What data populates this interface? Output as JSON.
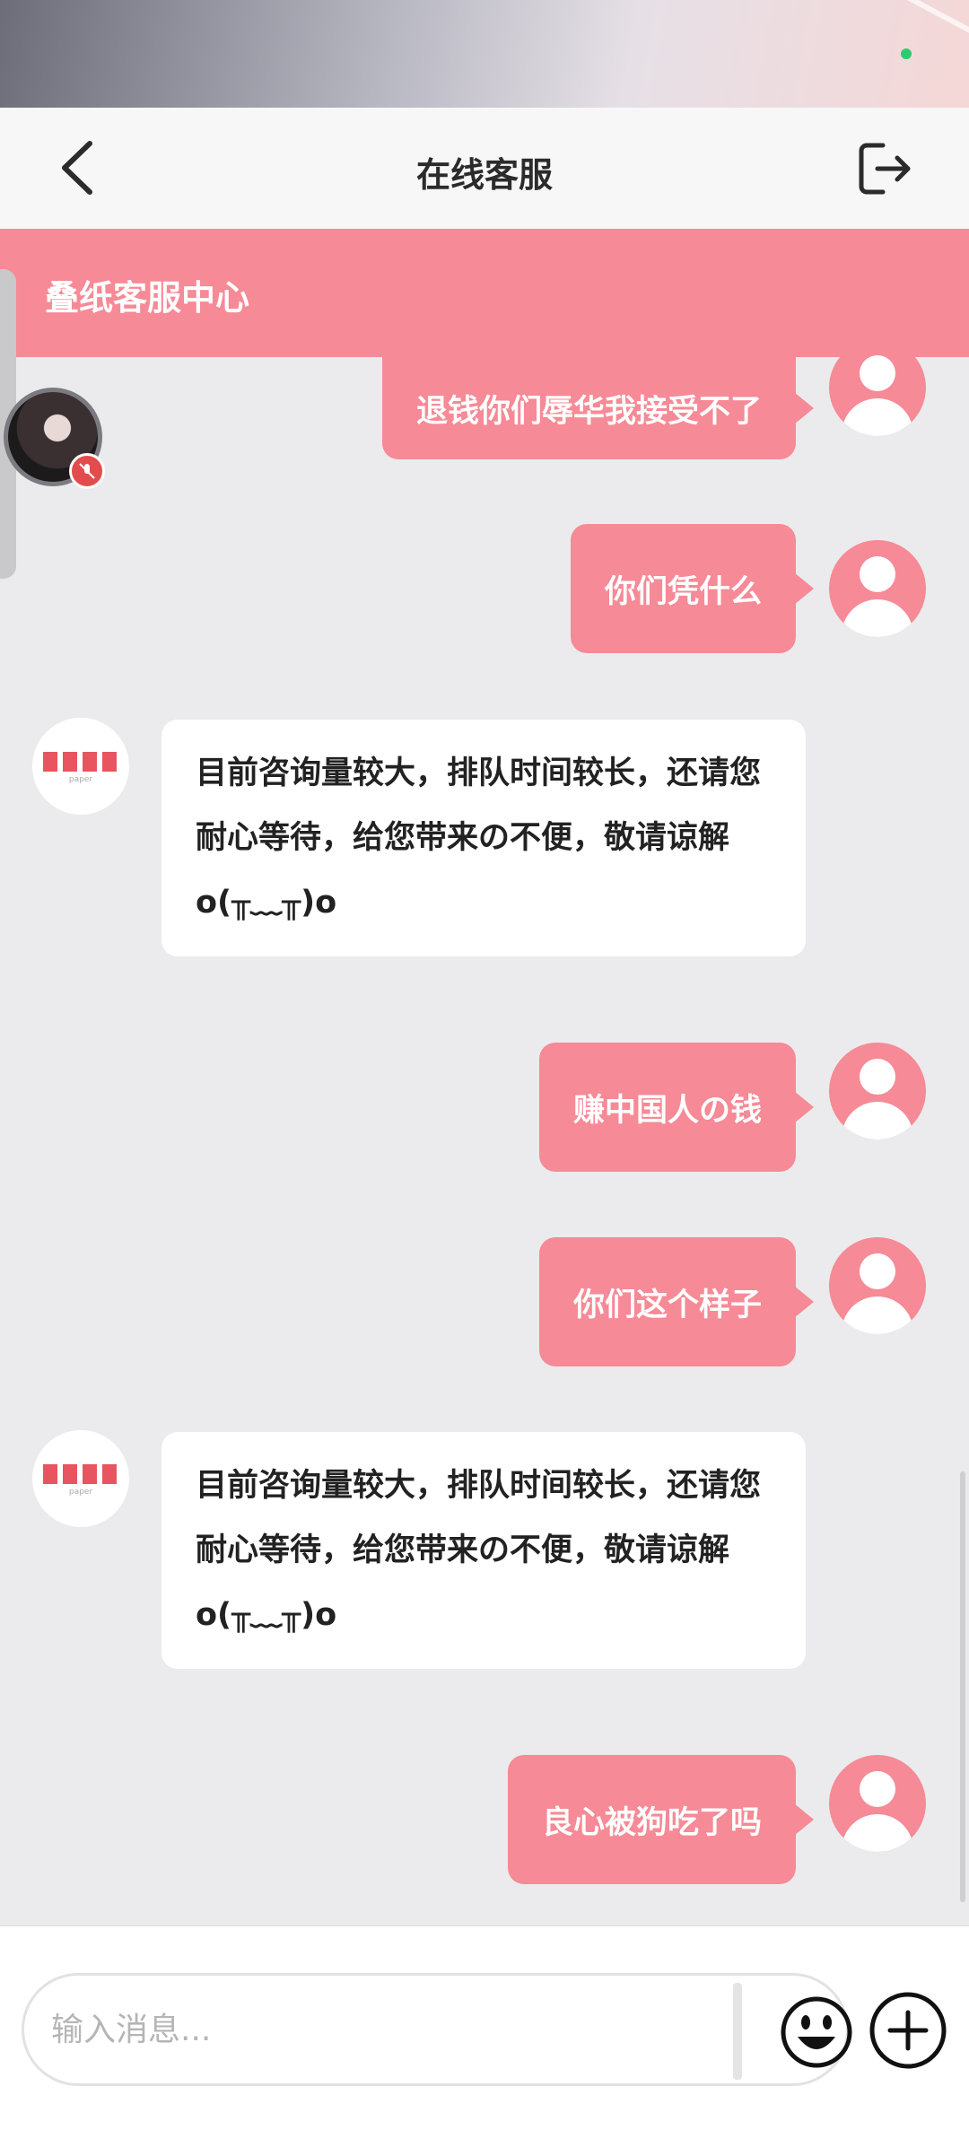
{
  "nav": {
    "title": "在线客服",
    "back_icon": "chevron-left-icon",
    "exit_icon": "logout-icon"
  },
  "banner": {
    "title": "叠纸客服中心"
  },
  "colors": {
    "accent": "#f68a96",
    "background": "#ebebed",
    "status_dot": "#2ecc71"
  },
  "messages": [
    {
      "from": "user",
      "text": "退钱你们辱华我接受不了"
    },
    {
      "from": "user",
      "text": "你们凭什么"
    },
    {
      "from": "bot",
      "text": "目前咨询量较大，排队时间较长，还请您耐心等待，给您带来の不便，敬请谅解o(╥﹏╥)o"
    },
    {
      "from": "user",
      "text": "赚中国人の钱"
    },
    {
      "from": "user",
      "text": "你们这个样子"
    },
    {
      "from": "bot",
      "text": "目前咨询量较大，排队时间较长，还请您耐心等待，给您带来の不便，敬请谅解o(╥﹏╥)o"
    },
    {
      "from": "user",
      "text": "良心被狗吃了吗"
    }
  ],
  "bot_logo": {
    "text": "paper"
  },
  "input": {
    "placeholder": "输入消息...",
    "value": ""
  }
}
